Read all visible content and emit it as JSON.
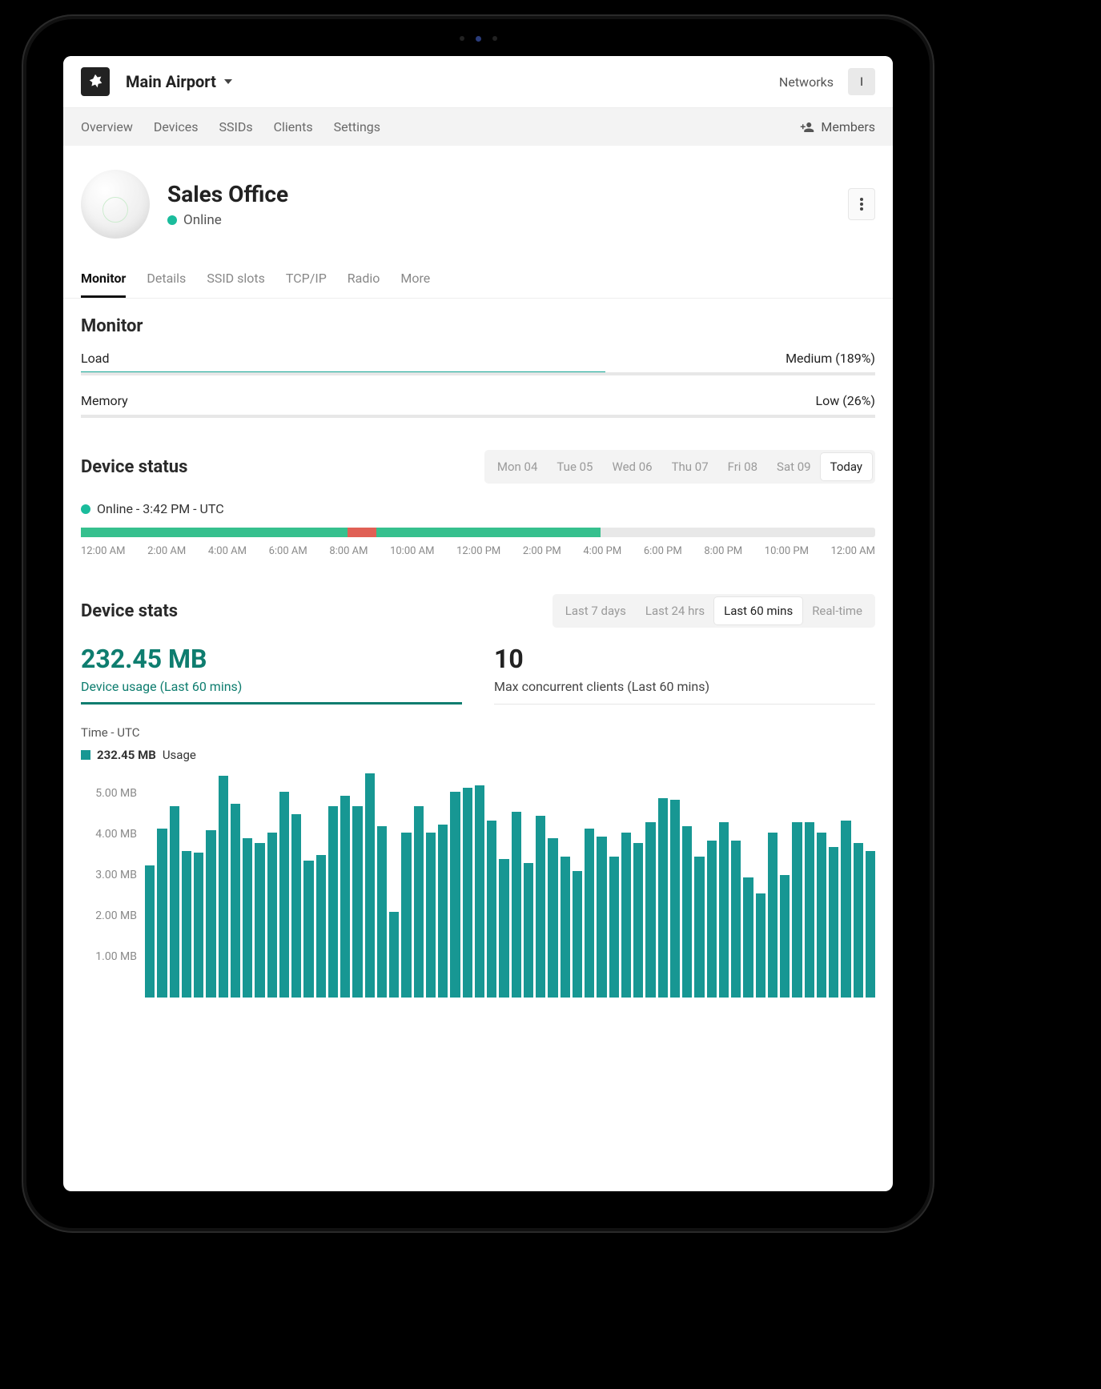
{
  "topbar": {
    "site_name": "Main Airport",
    "networks_link": "Networks",
    "avatar_initial": "I"
  },
  "subnav": {
    "items": [
      "Overview",
      "Devices",
      "SSIDs",
      "Clients",
      "Settings"
    ],
    "members_label": "Members"
  },
  "header": {
    "device_name": "Sales Office",
    "status_text": "Online"
  },
  "tabs": {
    "items": [
      "Monitor",
      "Details",
      "SSID slots",
      "TCP/IP",
      "Radio",
      "More"
    ],
    "active_index": 0
  },
  "monitor": {
    "title": "Monitor",
    "load": {
      "label": "Load",
      "value_text": "Medium (189%)",
      "top_pct": 66,
      "fill_pct": 33
    },
    "memory": {
      "label": "Memory",
      "value_text": "Low (26%)",
      "fill_pct": 33
    }
  },
  "device_status": {
    "title": "Device status",
    "days": [
      "Mon 04",
      "Tue 05",
      "Wed 06",
      "Thu 07",
      "Fri 08",
      "Sat 09",
      "Today"
    ],
    "active_day_index": 6,
    "status_line": "Online - 3:42 PM - UTC",
    "ticks": [
      "12:00 AM",
      "2:00 AM",
      "4:00 AM",
      "6:00 AM",
      "8:00 AM",
      "10:00 AM",
      "12:00 PM",
      "2:00 PM",
      "4:00 PM",
      "6:00 PM",
      "8:00 PM",
      "10:00 PM",
      "12:00 AM"
    ],
    "segments": [
      {
        "color": "green",
        "start_pct": 0,
        "end_pct": 33.6
      },
      {
        "color": "red",
        "start_pct": 33.6,
        "end_pct": 37.2
      },
      {
        "color": "green",
        "start_pct": 37.2,
        "end_pct": 65.4
      }
    ]
  },
  "device_stats": {
    "title": "Device stats",
    "ranges": [
      "Last 7 days",
      "Last 24 hrs",
      "Last 60 mins",
      "Real-time"
    ],
    "active_range_index": 2,
    "cards": [
      {
        "value": "232.45 MB",
        "label": "Device usage (Last 60 mins)",
        "active": true
      },
      {
        "value": "10",
        "label": "Max concurrent clients (Last 60 mins)",
        "active": false
      }
    ],
    "time_label": "Time - UTC",
    "legend": {
      "value": "232.45 MB",
      "word": "Usage"
    }
  },
  "chart_data": {
    "type": "bar",
    "title": "232.45 MB Usage",
    "ylabel": "MB",
    "ylim": [
      0,
      5.5
    ],
    "ytick_labels": [
      "1.00 MB",
      "2.00 MB",
      "3.00 MB",
      "4.00 MB",
      "5.00 MB"
    ],
    "yticks": [
      1.0,
      2.0,
      3.0,
      4.0,
      5.0
    ],
    "categories_count": 60,
    "values": [
      3.25,
      4.15,
      4.7,
      3.6,
      3.55,
      4.1,
      5.45,
      4.75,
      3.9,
      3.8,
      4.05,
      5.05,
      4.5,
      3.35,
      3.5,
      4.7,
      4.95,
      4.7,
      5.5,
      4.2,
      2.1,
      4.05,
      4.7,
      4.05,
      4.25,
      5.05,
      5.15,
      5.2,
      4.35,
      3.4,
      4.55,
      3.3,
      4.45,
      3.9,
      3.45,
      3.1,
      4.15,
      3.95,
      3.45,
      4.05,
      3.8,
      4.3,
      4.9,
      4.85,
      4.2,
      3.45,
      3.85,
      4.3,
      3.85,
      2.95,
      2.55,
      4.05,
      3.0,
      4.3,
      4.3,
      4.05,
      3.7,
      4.35,
      3.8,
      3.6
    ]
  }
}
